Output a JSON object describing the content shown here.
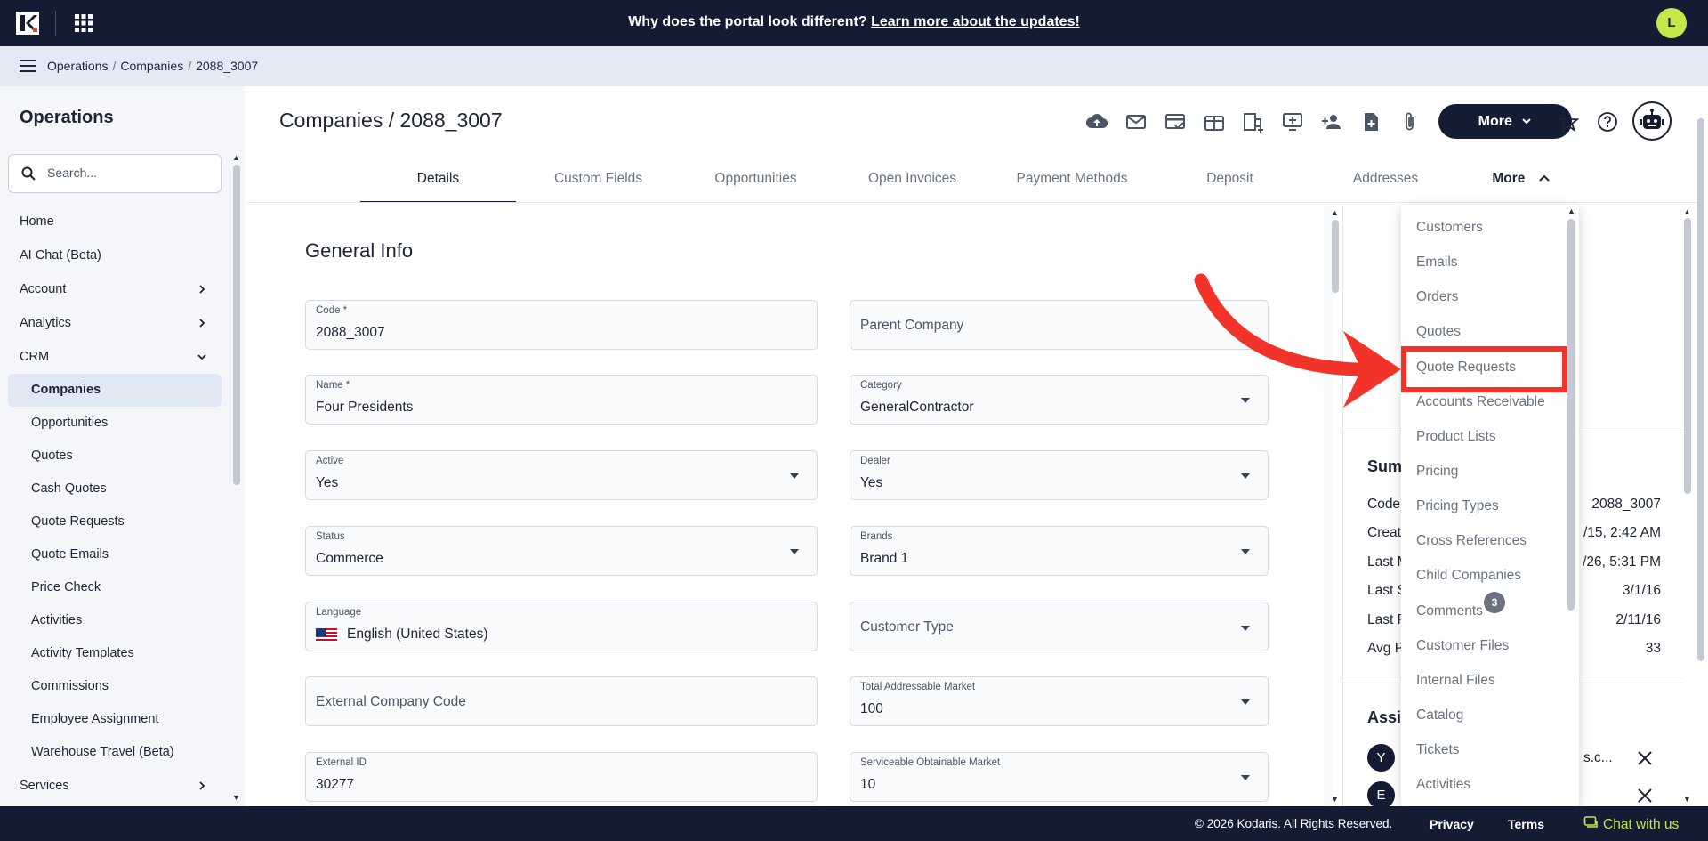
{
  "banner": {
    "text": "Why does the portal look different? ",
    "link": "Learn more about the updates!",
    "user_initial": "L"
  },
  "breadcrumb": [
    "Operations",
    "Companies",
    "2088_3007"
  ],
  "sidebar": {
    "title": "Operations",
    "search_placeholder": "Search...",
    "items": [
      {
        "label": "Home",
        "sub": false
      },
      {
        "label": "AI Chat (Beta)",
        "sub": false
      },
      {
        "label": "Account",
        "sub": false,
        "chevron": "right"
      },
      {
        "label": "Analytics",
        "sub": false,
        "chevron": "right"
      },
      {
        "label": "CRM",
        "sub": false,
        "chevron": "down"
      },
      {
        "label": "Companies",
        "sub": true,
        "active": true
      },
      {
        "label": "Opportunities",
        "sub": true
      },
      {
        "label": "Quotes",
        "sub": true
      },
      {
        "label": "Cash Quotes",
        "sub": true
      },
      {
        "label": "Quote Requests",
        "sub": true
      },
      {
        "label": "Quote Emails",
        "sub": true
      },
      {
        "label": "Price Check",
        "sub": true
      },
      {
        "label": "Activities",
        "sub": true
      },
      {
        "label": "Activity Templates",
        "sub": true
      },
      {
        "label": "Commissions",
        "sub": true
      },
      {
        "label": "Employee Assignment",
        "sub": true
      },
      {
        "label": "Warehouse Travel (Beta)",
        "sub": true
      },
      {
        "label": "Services",
        "sub": false,
        "chevron": "right"
      }
    ]
  },
  "header": {
    "title": "Companies / 2088_3007",
    "more_label": "More"
  },
  "tabs": [
    "Details",
    "Custom Fields",
    "Opportunities",
    "Open Invoices",
    "Payment Methods",
    "Deposit",
    "Addresses",
    "More"
  ],
  "form": {
    "section_title": "General Info",
    "code_label": "Code *",
    "code_value": "2088_3007",
    "parent_company_placeholder": "Parent Company",
    "name_label": "Name *",
    "name_value": "Four Presidents",
    "category_label": "Category",
    "category_value": "GeneralContractor",
    "active_label": "Active",
    "active_value": "Yes",
    "dealer_label": "Dealer",
    "dealer_value": "Yes",
    "status_label": "Status",
    "status_value": "Commerce",
    "brands_label": "Brands",
    "brands_value": "Brand 1",
    "language_label": "Language",
    "language_value": "English (United States)",
    "customer_type_placeholder": "Customer Type",
    "external_code_placeholder": "External Company Code",
    "tam_label": "Total Addressable Market",
    "tam_value": "100",
    "external_id_label": "External ID",
    "external_id_value": "30277",
    "som_label": "Serviceable Obtainable Market",
    "som_value": "10"
  },
  "summary": {
    "title": "Sum",
    "rows": [
      {
        "label": "Code",
        "value": "2088_3007"
      },
      {
        "label": "Creat",
        "value": "/15, 2:42 AM"
      },
      {
        "label": "Last M",
        "value": "/26, 5:31 PM"
      },
      {
        "label": "Last S",
        "value": "3/1/16"
      },
      {
        "label": "Last P",
        "value": "2/11/16"
      },
      {
        "label": "Avg P",
        "value": "33"
      }
    ],
    "assign_title": "Assig",
    "assignees": [
      {
        "initial": "Y",
        "text": "s.c..."
      },
      {
        "initial": "E",
        "text": ""
      }
    ]
  },
  "more_menu": {
    "items": [
      "Customers",
      "Emails",
      "Orders",
      "Quotes",
      "Quote Requests",
      "Accounts Receivable",
      "Product Lists",
      "Pricing",
      "Pricing Types",
      "Cross References",
      "Child Companies",
      "Comments",
      "Customer Files",
      "Internal Files",
      "Catalog",
      "Tickets",
      "Activities"
    ],
    "comments_badge": "3",
    "highlighted": "Quote Requests"
  },
  "footer": {
    "copyright": "© 2026 Kodaris. All Rights Reserved.",
    "privacy": "Privacy",
    "terms": "Terms",
    "chat": "Chat with us"
  },
  "colors": {
    "navy": "#131c33",
    "accent_green": "#c4e84a",
    "highlight_red": "#f2332a"
  }
}
